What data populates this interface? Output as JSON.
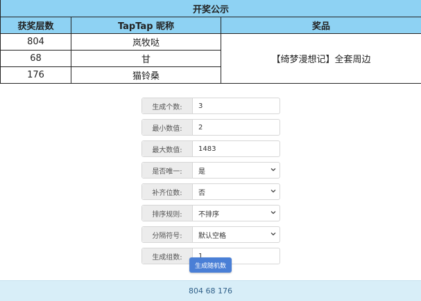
{
  "winners": {
    "title": "开奖公示",
    "headers": [
      "获奖层数",
      "TapTap 昵称",
      "奖品"
    ],
    "rows": [
      {
        "floor": "804",
        "nickname": "岚牧哒"
      },
      {
        "floor": "68",
        "nickname": "甘"
      },
      {
        "floor": "176",
        "nickname": "猫铃桑"
      }
    ],
    "prize": "【绮梦漫想记】全套周边"
  },
  "form": {
    "count_label": "生成个数:",
    "count_value": "3",
    "min_label": "最小数值:",
    "min_value": "2",
    "max_label": "最大数值:",
    "max_value": "1483",
    "unique_label": "是否唯一:",
    "unique_value": "是",
    "pad_label": "补齐位数:",
    "pad_value": "否",
    "sort_label": "排序规则:",
    "sort_value": "不排序",
    "sep_label": "分隔符号:",
    "sep_value": "默认空格",
    "groups_label": "生成组数:",
    "groups_value": "1",
    "generate_label": "生成随机数"
  },
  "result": {
    "text": "804 68 176"
  }
}
